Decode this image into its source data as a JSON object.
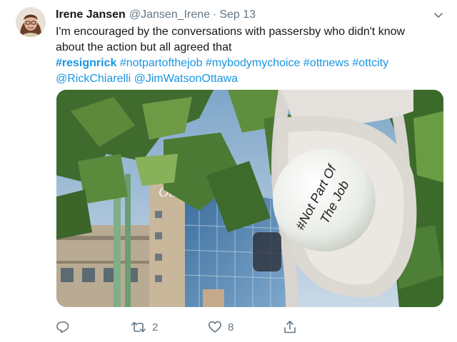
{
  "tweet": {
    "author_name": "Irene Jansen",
    "author_handle": "@Jansen_Irene",
    "separator": "·",
    "date": "Sep 13",
    "text_line1": "I'm encouraged by the conversations with passersby who didn't know",
    "text_line2": "about the action but all agreed that",
    "hashtags": [
      "#resignrick",
      "#notpartofthejob",
      "#mybodymychoice",
      "#ottnews",
      "#ottcity"
    ],
    "mentions": [
      "@RickChiarelli",
      "@JimWatsonOttawa"
    ]
  },
  "media": {
    "building_sign": "Ottawa",
    "ball_text_line1": "#Not Part Of",
    "ball_text_line2": "The Job"
  },
  "actions": {
    "reply_icon": "reply-icon",
    "retweet_icon": "retweet-icon",
    "retweet_count": "2",
    "like_icon": "heart-icon",
    "like_count": "8",
    "share_icon": "share-icon"
  },
  "colors": {
    "link": "#1b95e0",
    "muted": "#657786",
    "text": "#14171a"
  }
}
